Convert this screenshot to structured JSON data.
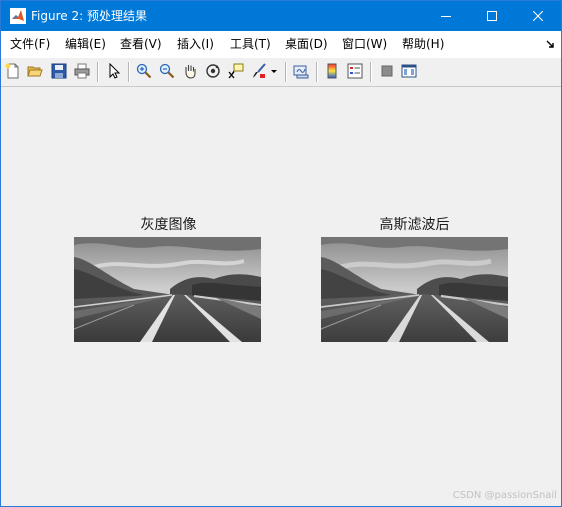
{
  "window": {
    "title": "Figure 2: 预处理结果",
    "accent_color": "#0078d7",
    "icon": "matlab-icon",
    "controls": [
      "minimize-icon",
      "maximize-icon",
      "close-icon"
    ]
  },
  "menubar": {
    "items": [
      {
        "label": "文件(F)"
      },
      {
        "label": "编辑(E)"
      },
      {
        "label": "查看(V)"
      },
      {
        "label": "插入(I)"
      },
      {
        "label": "工具(T)"
      },
      {
        "label": "桌面(D)"
      },
      {
        "label": "窗口(W)"
      },
      {
        "label": "帮助(H)"
      }
    ],
    "overflow_icon": "menu-overflow-arrow-icon"
  },
  "toolbar": {
    "tools": [
      "new-figure-icon",
      "open-file-icon",
      "save-icon",
      "print-icon",
      "edit-plot-arrow-icon",
      "zoom-in-icon",
      "zoom-out-icon",
      "pan-hand-icon",
      "rotate-3d-icon",
      "data-cursor-icon",
      "brush-icon",
      "brush-dropdown-icon",
      "link-plot-icon",
      "colorbar-icon",
      "legend-icon",
      "hide-plot-tools-icon",
      "show-plot-tools-icon"
    ]
  },
  "figure": {
    "axes": [
      {
        "title": "灰度图像"
      },
      {
        "title": "高斯滤波后"
      }
    ]
  },
  "watermark": "CSDN @passionSnail"
}
